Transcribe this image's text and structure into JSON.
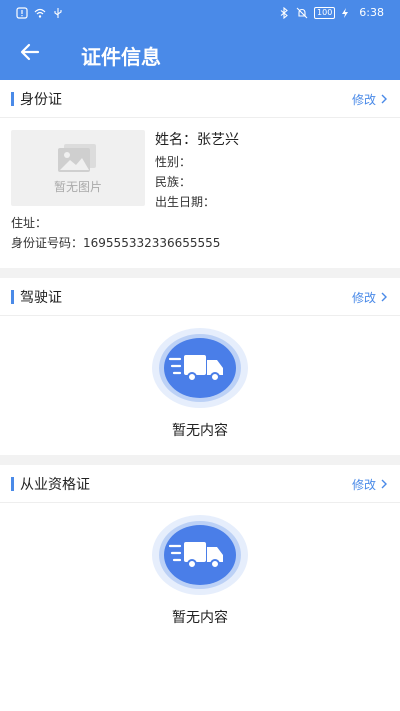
{
  "status_bar": {
    "time": "6:38",
    "battery": "100"
  },
  "header": {
    "title": "证件信息"
  },
  "id_card": {
    "title": "身份证",
    "edit_label": "修改",
    "photo_placeholder": "暂无图片",
    "name_label": "姓名：",
    "name_value": "张艺兴",
    "gender_label": "性别：",
    "ethnicity_label": "民族：",
    "birth_label": "出生日期：",
    "address_label": "住址：",
    "id_number_label": "身份证号码：",
    "id_number_value": "169555332336655555"
  },
  "driver_license": {
    "title": "驾驶证",
    "edit_label": "修改",
    "empty_text": "暂无内容"
  },
  "qualification": {
    "title": "从业资格证",
    "edit_label": "修改",
    "empty_text": "暂无内容"
  },
  "colors": {
    "primary": "#4a8ae8",
    "divider": "#f2f2f2"
  }
}
